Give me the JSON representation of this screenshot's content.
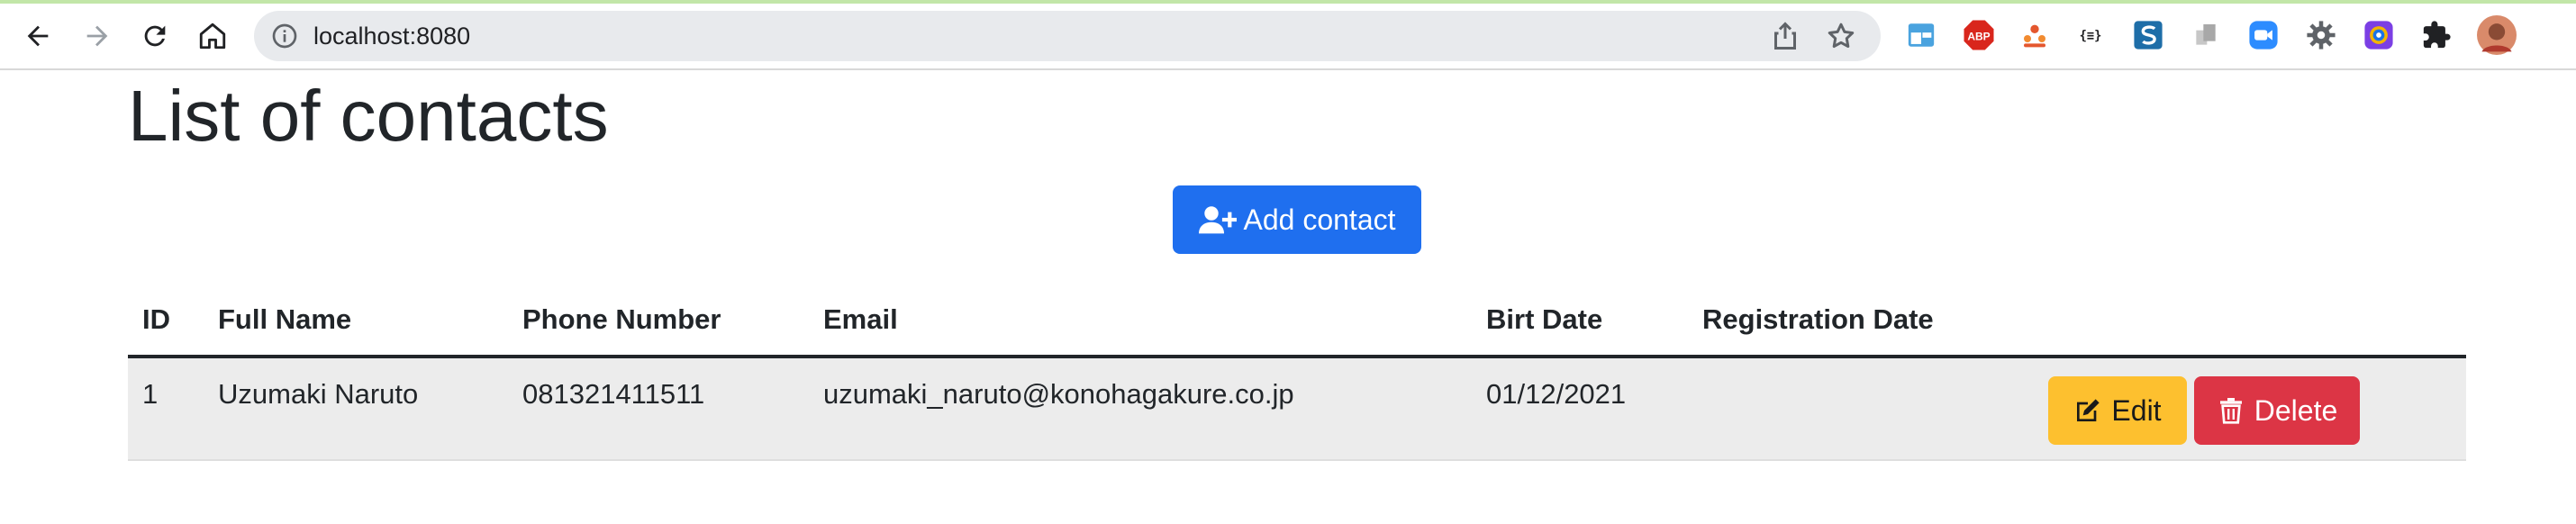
{
  "browser": {
    "url": "localhost:8080",
    "extensions": [
      {
        "name": "tab-manager-icon",
        "color": "#1a73e8"
      },
      {
        "name": "adblock-plus-icon",
        "color": "#d9261c",
        "text": "ABP"
      },
      {
        "name": "users-extension-icon",
        "color": "#e4572e"
      },
      {
        "name": "json-formatter-icon",
        "text": "{≡}"
      },
      {
        "name": "s-extension-icon",
        "color": "#1e6ea8"
      },
      {
        "name": "grey-extension-icon",
        "color": "#b0b0b0"
      },
      {
        "name": "zoom-icon",
        "color": "#2d8cff"
      },
      {
        "name": "settings-gear-icon",
        "color": "#5f6368"
      },
      {
        "name": "color-picker-icon",
        "color": "#7b3fe4"
      },
      {
        "name": "puzzle-extensions-icon",
        "color": "#202124"
      },
      {
        "name": "profile-avatar-icon",
        "color": "#c96b4e"
      }
    ]
  },
  "page": {
    "title": "List of contacts",
    "add_button_label": "Add contact"
  },
  "table": {
    "headers": {
      "id": "ID",
      "full_name": "Full Name",
      "phone": "Phone Number",
      "email": "Email",
      "birth_date": "Birt Date",
      "registration_date": "Registration Date"
    },
    "rows": [
      {
        "id": "1",
        "full_name": "Uzumaki Naruto",
        "phone": "081321411511",
        "email": "uzumaki_naruto@konohagakure.co.jp",
        "birth_date": "01/12/2021",
        "registration_date": "",
        "edit_label": "Edit",
        "delete_label": "Delete"
      }
    ]
  },
  "colors": {
    "primary": "#1f6fef",
    "warning": "#fdc02f",
    "danger": "#dc3545",
    "row_background": "#ececec"
  }
}
